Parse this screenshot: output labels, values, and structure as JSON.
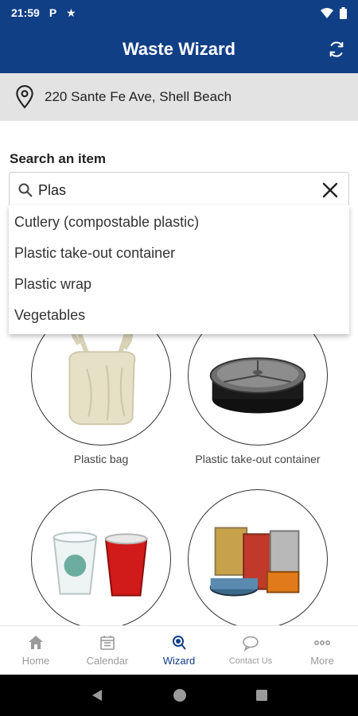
{
  "status": {
    "time": "21:59",
    "notif1": "P",
    "notif2": "★"
  },
  "app": {
    "title": "Waste Wizard"
  },
  "address": {
    "text": "220 Sante Fe Ave, Shell Beach"
  },
  "search": {
    "label": "Search an item",
    "value": "Plas"
  },
  "suggestions": [
    "Cutlery (compostable plastic)",
    "Plastic take-out container",
    "Plastic wrap",
    "Vegetables"
  ],
  "items": [
    {
      "caption": "Plastic bag"
    },
    {
      "caption": "Plastic take-out container"
    },
    {
      "caption": ""
    },
    {
      "caption": ""
    }
  ],
  "nav": [
    {
      "label": "Home",
      "icon": "home-icon"
    },
    {
      "label": "Calendar",
      "icon": "calendar-icon"
    },
    {
      "label": "Wizard",
      "icon": "wizard-icon",
      "active": true
    },
    {
      "label": "Contact Us",
      "icon": "chat-icon"
    },
    {
      "label": "More",
      "icon": "more-icon"
    }
  ],
  "colors": {
    "brand": "#113f86",
    "inactive": "#9a9a9a"
  }
}
